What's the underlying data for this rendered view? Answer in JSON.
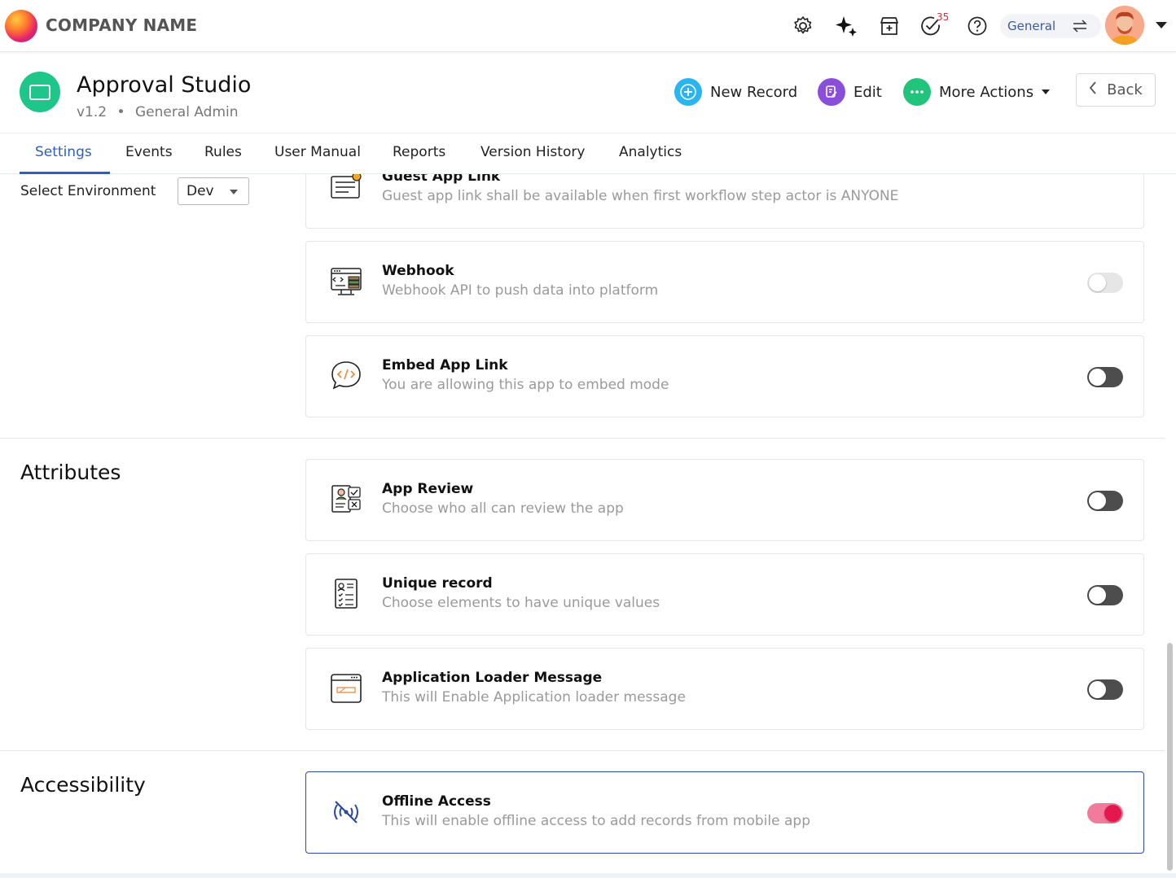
{
  "header": {
    "company_name": "COMPANY NAME",
    "notification_count": "35",
    "workspace": "General",
    "icons": [
      "settings-gear-icon",
      "ai-sparkle-icon",
      "store-icon",
      "tasks-check-icon",
      "help-icon",
      "swap-icon"
    ]
  },
  "app": {
    "title": "Approval Studio",
    "version": "v1.2",
    "role": "General Admin",
    "bullet": "•",
    "accent_color": "#1ec68a"
  },
  "actions": {
    "new_record": "New Record",
    "edit": "Edit",
    "more_actions": "More Actions",
    "back": "Back",
    "colors": {
      "new_record": "#2ab4f0",
      "edit": "#8a4fd8",
      "more_actions": "#22c37a"
    }
  },
  "tabs": [
    {
      "label": "Settings",
      "active": true
    },
    {
      "label": "Events"
    },
    {
      "label": "Rules"
    },
    {
      "label": "User Manual"
    },
    {
      "label": "Reports"
    },
    {
      "label": "Version History"
    },
    {
      "label": "Analytics"
    }
  ],
  "environment": {
    "label": "Select Environment",
    "value": "Dev"
  },
  "sections": {
    "attributes": "Attributes",
    "accessibility": "Accessibility"
  },
  "cards": [
    {
      "title": "Guest App Link",
      "desc": "Guest app link shall be available when first workflow step actor is ANYONE",
      "icon": "guest-link-icon"
    },
    {
      "title": "Webhook",
      "desc": "Webhook API to push data into platform",
      "icon": "webhook-icon",
      "enabled": false
    },
    {
      "title": "Embed App Link",
      "desc": "You are allowing this app to embed mode",
      "icon": "embed-code-icon",
      "enabled": false
    },
    {
      "title": "App Review",
      "desc": "Choose who all can review the app",
      "icon": "app-review-icon",
      "enabled": false
    },
    {
      "title": "Unique record",
      "desc": "Choose elements to have unique values",
      "icon": "unique-record-icon",
      "enabled": false
    },
    {
      "title": "Application Loader Message",
      "desc": "This will Enable Application loader message",
      "icon": "loader-window-icon",
      "enabled": false
    },
    {
      "title": "Offline Access",
      "desc": "This will enable offline access to add records from mobile app",
      "icon": "offline-signal-icon",
      "enabled": true
    }
  ]
}
